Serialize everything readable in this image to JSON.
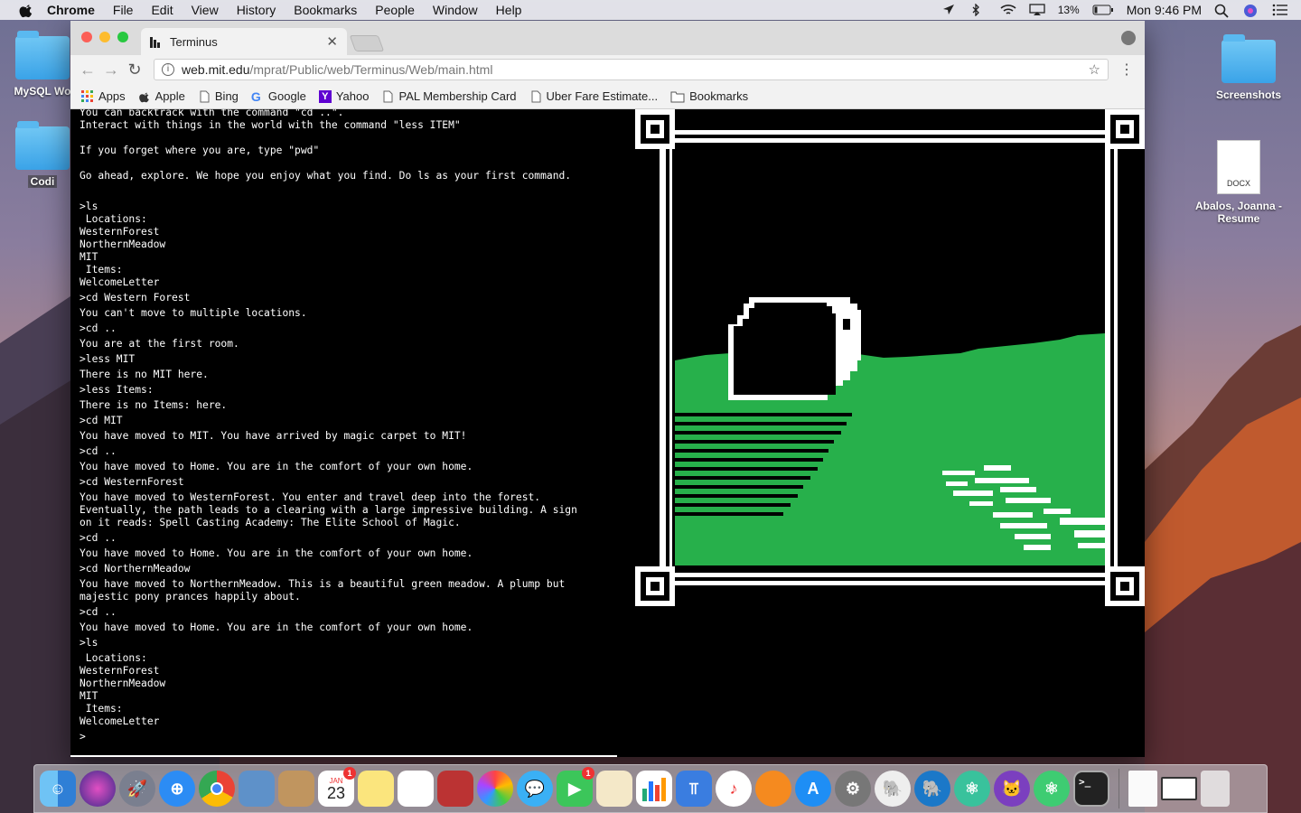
{
  "menubar": {
    "app": "Chrome",
    "items": [
      "File",
      "Edit",
      "View",
      "History",
      "Bookmarks",
      "People",
      "Window",
      "Help"
    ],
    "battery": "13%",
    "clock": "Mon 9:46 PM"
  },
  "desktop": {
    "left_icons": [
      "MySQL Wo",
      "Codi"
    ],
    "right_icons": [
      "Screenshots",
      "Abalos, Joanna - Resume"
    ],
    "docx_label": "DOCX"
  },
  "browser": {
    "tab_title": "Terminus",
    "url_host": "web.mit.edu",
    "url_path": "/mprat/Public/web/Terminus/Web/main.html",
    "bookmarks": [
      "Apps",
      "Apple",
      "Bing",
      "Google",
      "Yahoo",
      "PAL Membership Card",
      "Uber Fare Estimate...",
      "Bookmarks"
    ]
  },
  "terminal": {
    "intro": [
      "You can backtrack with the command \"cd ..\".",
      "Interact with things in the world with the command \"less ITEM\"",
      "",
      "If you forget where you are, type \"pwd\"",
      "",
      "Go ahead, explore. We hope you enjoy what you find. Do ls as your first command.",
      ""
    ],
    "log": [
      {
        "t": "cmd",
        "text": ">ls"
      },
      {
        "t": "out",
        "text": " Locations:"
      },
      {
        "t": "out",
        "text": "WesternForest"
      },
      {
        "t": "out",
        "text": "NorthernMeadow"
      },
      {
        "t": "out",
        "text": "MIT"
      },
      {
        "t": "out",
        "text": " Items:"
      },
      {
        "t": "out",
        "text": "WelcomeLetter"
      },
      {
        "t": "cmd",
        "text": ">cd Western Forest"
      },
      {
        "t": "cmd",
        "text": "You can't move to multiple locations."
      },
      {
        "t": "cmd",
        "text": ">cd .."
      },
      {
        "t": "cmd",
        "text": "You are at the first room."
      },
      {
        "t": "cmd",
        "text": ">less MIT"
      },
      {
        "t": "cmd",
        "text": "There is no MIT here."
      },
      {
        "t": "cmd",
        "text": ">less Items:"
      },
      {
        "t": "cmd",
        "text": "There is no Items: here."
      },
      {
        "t": "cmd",
        "text": ">cd MIT"
      },
      {
        "t": "cmd",
        "text": "You have moved to MIT. You have arrived by magic carpet to MIT!"
      },
      {
        "t": "cmd",
        "text": ">cd .."
      },
      {
        "t": "cmd",
        "text": "You have moved to Home. You are in the comfort of your own home."
      },
      {
        "t": "cmd",
        "text": ">cd WesternForest"
      },
      {
        "t": "cmd",
        "text": "You have moved to WesternForest. You enter and travel deep into the forest."
      },
      {
        "t": "out",
        "text": "Eventually, the path leads to a clearing with a large impressive building. A sign"
      },
      {
        "t": "out",
        "text": "on it reads: Spell Casting Academy: The Elite School of Magic."
      },
      {
        "t": "cmd",
        "text": ">cd .."
      },
      {
        "t": "cmd",
        "text": "You have moved to Home. You are in the comfort of your own home."
      },
      {
        "t": "cmd",
        "text": ">cd NorthernMeadow"
      },
      {
        "t": "cmd",
        "text": "You have moved to NorthernMeadow. This is a beautiful green meadow. A plump but"
      },
      {
        "t": "out",
        "text": "majestic pony prances happily about."
      },
      {
        "t": "cmd",
        "text": ">cd .."
      },
      {
        "t": "cmd",
        "text": "You have moved to Home. You are in the comfort of your own home."
      },
      {
        "t": "cmd",
        "text": ">ls"
      },
      {
        "t": "cmd",
        "text": " Locations:"
      },
      {
        "t": "out",
        "text": "WesternForest"
      },
      {
        "t": "out",
        "text": "NorthernMeadow"
      },
      {
        "t": "out",
        "text": "MIT"
      },
      {
        "t": "out",
        "text": " Items:"
      },
      {
        "t": "out",
        "text": "WelcomeLetter"
      },
      {
        "t": "cmd",
        "text": ">"
      }
    ]
  },
  "dock": {
    "calendar_month": "JAN",
    "calendar_day": "23",
    "calendar_badge": "1",
    "facetime_badge": "1",
    "apps": [
      "finder",
      "siri",
      "launchpad",
      "safari",
      "chrome",
      "preview",
      "contacts",
      "calendar",
      "notes",
      "reminders",
      "photo-booth",
      "photos",
      "messages",
      "facetime",
      "textedit",
      "numbers",
      "keynote",
      "itunes",
      "ibooks",
      "app-store",
      "system-preferences",
      "sequel-pro",
      "mysql-workbench",
      "atom",
      "github-desktop",
      "atom-beta",
      "terminal",
      "document",
      "window",
      "trash"
    ]
  },
  "colors": {
    "meadow_green": "#27b04b",
    "terminal_bg": "#000000",
    "terminal_text": "#ffffff"
  }
}
